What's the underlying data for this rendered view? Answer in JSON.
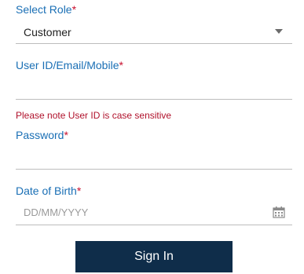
{
  "form": {
    "role": {
      "label": "Select Role",
      "required_mark": "*",
      "selected_value": "Customer"
    },
    "user_id": {
      "label": "User ID/Email/Mobile",
      "required_mark": "*",
      "value": "",
      "hint": "Please note User ID is case sensitive"
    },
    "password": {
      "label": "Password",
      "required_mark": "*",
      "value": ""
    },
    "dob": {
      "label": "Date of Birth",
      "required_mark": "*",
      "placeholder": "DD/MM/YYYY"
    },
    "submit_label": "Sign In"
  },
  "colors": {
    "label": "#1a6fb5",
    "required": "#c8102e",
    "hint": "#b0112b",
    "button_bg": "#0f2d4a",
    "button_text": "#ffffff",
    "underline": "#bdbdbd"
  },
  "icons": {
    "role_dropdown": "chevron-down-icon",
    "dob_picker": "calendar-icon"
  }
}
